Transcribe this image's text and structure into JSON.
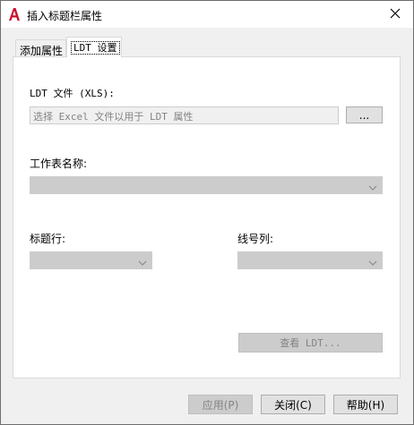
{
  "window": {
    "title": "插入标题栏属性",
    "icon": "autocad-logo-icon",
    "close_icon": "close-icon"
  },
  "tabs": [
    {
      "label": "添加属性",
      "active": false
    },
    {
      "label": "LDT 设置",
      "active": true
    }
  ],
  "ldt_file": {
    "label": "LDT 文件 (XLS):",
    "placeholder": "选择 Excel 文件以用于 LDT 属性",
    "browse_label": "..."
  },
  "worksheet": {
    "label": "工作表名称:",
    "value": ""
  },
  "title_row": {
    "label": "标题行:",
    "value": ""
  },
  "line_number_column": {
    "label": "线号列:",
    "value": ""
  },
  "view_ldt_button": "查看 LDT...",
  "footer": {
    "apply": "应用(P)",
    "close": "关闭(C)",
    "help": "帮助(H)"
  },
  "colors": {
    "disabled_fill": "#cccccc",
    "disabled_text": "#838383",
    "logo_red": "#c8102e"
  }
}
